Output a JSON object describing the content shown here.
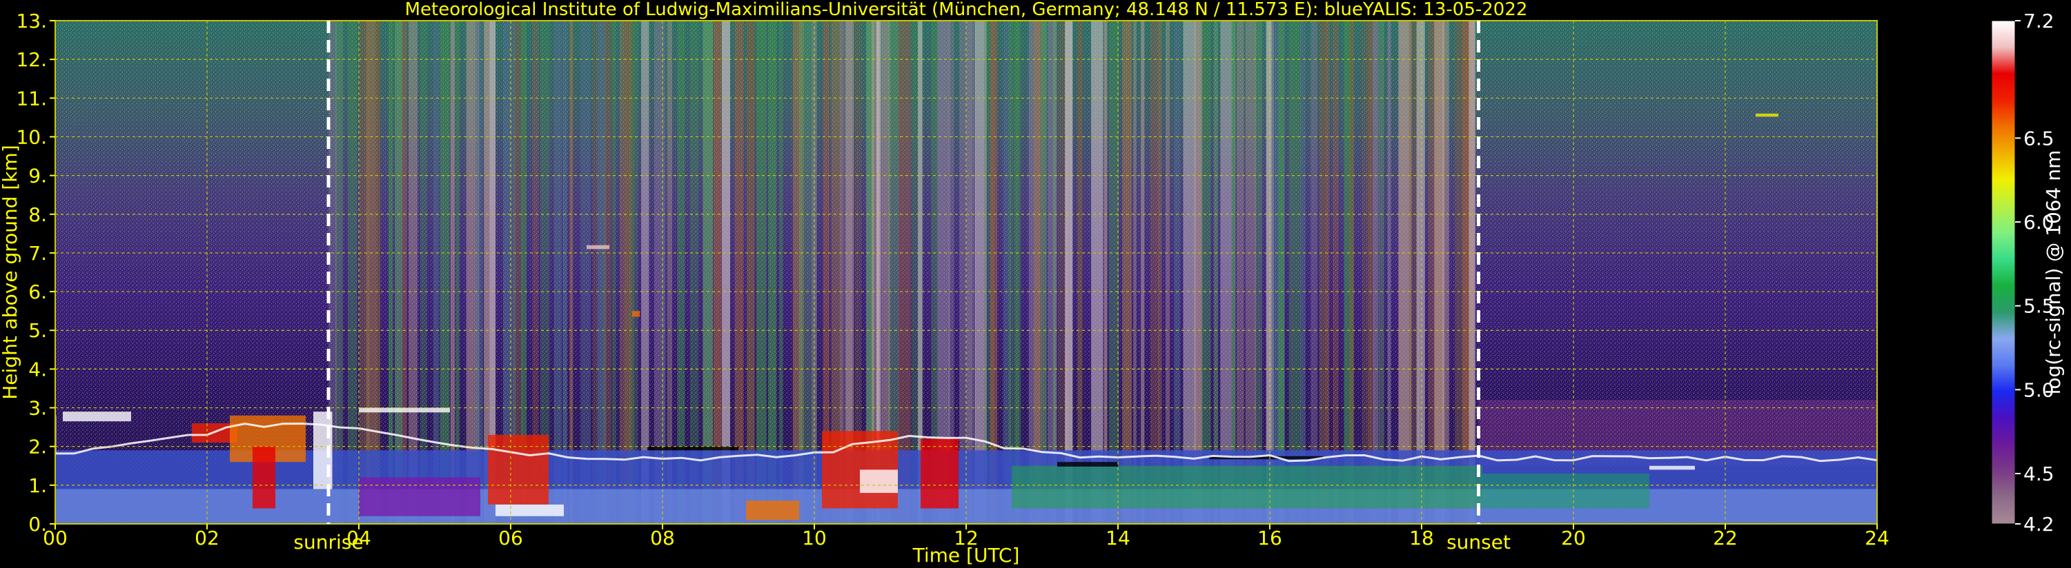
{
  "chart_data": {
    "type": "heatmap",
    "title": "Meteorological Institute of Ludwig-Maximilians-Universität (München, Germany; 48.148 N / 11.573 E):    blueYALIS: 13-05-2022",
    "xlabel": "Time [UTC]",
    "ylabel": "Height above ground [km]",
    "colorbar_label": "log(rc-signal) @ 1064 nm",
    "xlim": [
      0,
      24
    ],
    "ylim": [
      0,
      13
    ],
    "clim": [
      4.2,
      7.2
    ],
    "x_ticks": [
      0,
      2,
      4,
      6,
      8,
      10,
      12,
      14,
      16,
      18,
      20,
      22,
      24
    ],
    "x_tick_labels": [
      "00",
      "02",
      "04",
      "06",
      "08",
      "10",
      "12",
      "14",
      "16",
      "18",
      "20",
      "22",
      "24"
    ],
    "y_ticks": [
      0,
      1,
      2,
      3,
      4,
      5,
      6,
      7,
      8,
      9,
      10,
      11,
      12,
      13
    ],
    "y_tick_labels": [
      "0.",
      "1.",
      "2.",
      "3.",
      "4.",
      "5.",
      "6.",
      "7.",
      "8.",
      "9.",
      "10.",
      "11.",
      "12.",
      "13."
    ],
    "colorbar_ticks": [
      4.2,
      4.5,
      5.0,
      5.5,
      6.0,
      6.5,
      7.2
    ],
    "colorbar_tick_labels": [
      "4.2",
      "4.5",
      "5.0",
      "5.5",
      "6.0",
      "6.5",
      "7.2"
    ],
    "grid": true,
    "annotations": [
      {
        "text": "sunrise",
        "x": 3.6
      },
      {
        "text": "sunset",
        "x": 18.75
      }
    ],
    "colormap": [
      "#a88a98",
      "#8c6a88",
      "#7a3a86",
      "#6a1a9a",
      "#4a10c0",
      "#1a28f0",
      "#5a7af0",
      "#8aa8f0",
      "#2a9a6a",
      "#18b040",
      "#3adc88",
      "#80f080",
      "#b8f040",
      "#f0f000",
      "#f0b000",
      "#f07000",
      "#f02000",
      "#e80000",
      "#f0c0c0",
      "#ffffff"
    ],
    "colors": {
      "text": "#ffff00",
      "grid": "#c8c800",
      "marker_line": "#ffffff"
    }
  }
}
